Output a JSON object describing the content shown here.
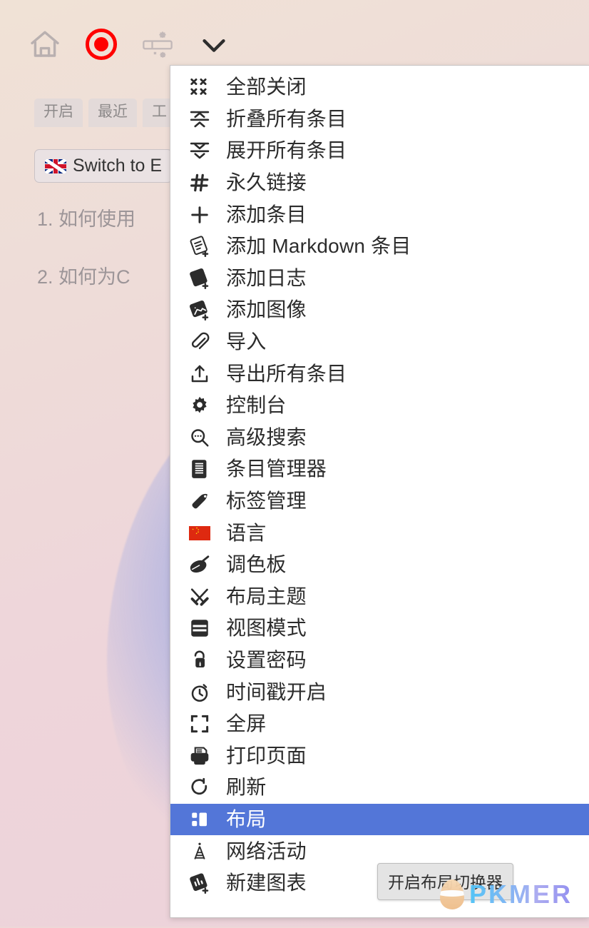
{
  "app": {
    "background_color": "#eed6da",
    "accent_color": "#5376d8"
  },
  "toolbar": {
    "icons": [
      {
        "name": "home-icon",
        "label": "主页"
      },
      {
        "name": "record-icon",
        "label": "录制"
      },
      {
        "name": "layout-toggle-icon",
        "label": "布局切换器"
      },
      {
        "name": "chevron-down-icon",
        "label": "更多"
      }
    ]
  },
  "tabs": [
    {
      "label": "开启"
    },
    {
      "label": "最近"
    },
    {
      "label": "工"
    }
  ],
  "language_switch": {
    "label": "Switch to E",
    "flag": "uk-flag-icon"
  },
  "outline": [
    {
      "text": "1. 如何使用"
    },
    {
      "text": "2. 如何为C"
    }
  ],
  "menu": {
    "items": [
      {
        "icon": "close-all-icon",
        "label": "全部关闭",
        "selected": false
      },
      {
        "icon": "collapse-all-icon",
        "label": "折叠所有条目",
        "selected": false
      },
      {
        "icon": "expand-all-icon",
        "label": "展开所有条目",
        "selected": false
      },
      {
        "icon": "permalink-hash-icon",
        "label": "永久链接",
        "selected": false
      },
      {
        "icon": "plus-icon",
        "label": "添加条目",
        "selected": false
      },
      {
        "icon": "add-markdown-icon",
        "label": "添加 Markdown 条目",
        "selected": false
      },
      {
        "icon": "add-journal-icon",
        "label": "添加日志",
        "selected": false
      },
      {
        "icon": "add-image-icon",
        "label": "添加图像",
        "selected": false
      },
      {
        "icon": "paperclip-import-icon",
        "label": "导入",
        "selected": false
      },
      {
        "icon": "export-upload-icon",
        "label": "导出所有条目",
        "selected": false
      },
      {
        "icon": "gear-icon",
        "label": "控制台",
        "selected": false
      },
      {
        "icon": "advanced-search-icon",
        "label": "高级搜索",
        "selected": false
      },
      {
        "icon": "entry-manager-icon",
        "label": "条目管理器",
        "selected": false
      },
      {
        "icon": "tag-manager-icon",
        "label": "标签管理",
        "selected": false
      },
      {
        "icon": "china-flag-icon",
        "label": "语言",
        "selected": false
      },
      {
        "icon": "palette-icon",
        "label": "调色板",
        "selected": false
      },
      {
        "icon": "tools-theme-icon",
        "label": "布局主题",
        "selected": false
      },
      {
        "icon": "view-mode-icon",
        "label": "视图模式",
        "selected": false
      },
      {
        "icon": "password-lock-icon",
        "label": "设置密码",
        "selected": false
      },
      {
        "icon": "timestamp-clock-icon",
        "label": "时间戳开启",
        "selected": false
      },
      {
        "icon": "fullscreen-icon",
        "label": "全屏",
        "selected": false
      },
      {
        "icon": "print-icon",
        "label": "打印页面",
        "selected": false
      },
      {
        "icon": "refresh-icon",
        "label": "刷新",
        "selected": false
      },
      {
        "icon": "layout-icon",
        "label": "布局",
        "selected": true
      },
      {
        "icon": "network-activity-icon",
        "label": "网络活动",
        "selected": false
      },
      {
        "icon": "new-chart-icon",
        "label": "新建图表",
        "selected": false
      }
    ]
  },
  "tooltip": {
    "text": "开启布局切换器"
  },
  "watermark": {
    "text": "PKMER"
  }
}
